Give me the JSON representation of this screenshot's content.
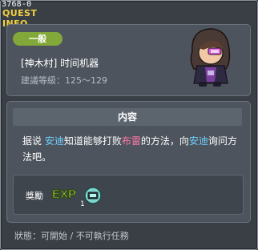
{
  "quest": {
    "id": "3768-0",
    "window_title": "QUEST INFO",
    "category": "一般",
    "name": "[神木村] 时间机器",
    "level_range": "建議等級：125～129"
  },
  "content": {
    "section_title": "内容",
    "description": {
      "part1": "据说",
      "npc1": "安迪",
      "part2": "知道能够打败",
      "target": "布雷",
      "part3": "的方法，向",
      "npc2": "安迪",
      "part4": "询问方法吧。"
    }
  },
  "rewards": {
    "label": "獎勵",
    "exp_text": "EXP",
    "item_count": "1"
  },
  "status": "狀態：可開始 / 不可執行任務",
  "colors": {
    "title": "#f4d040",
    "badge": "#82a83a",
    "highlight_npc": "#6fd0ff",
    "highlight_target": "#ff78a6"
  }
}
